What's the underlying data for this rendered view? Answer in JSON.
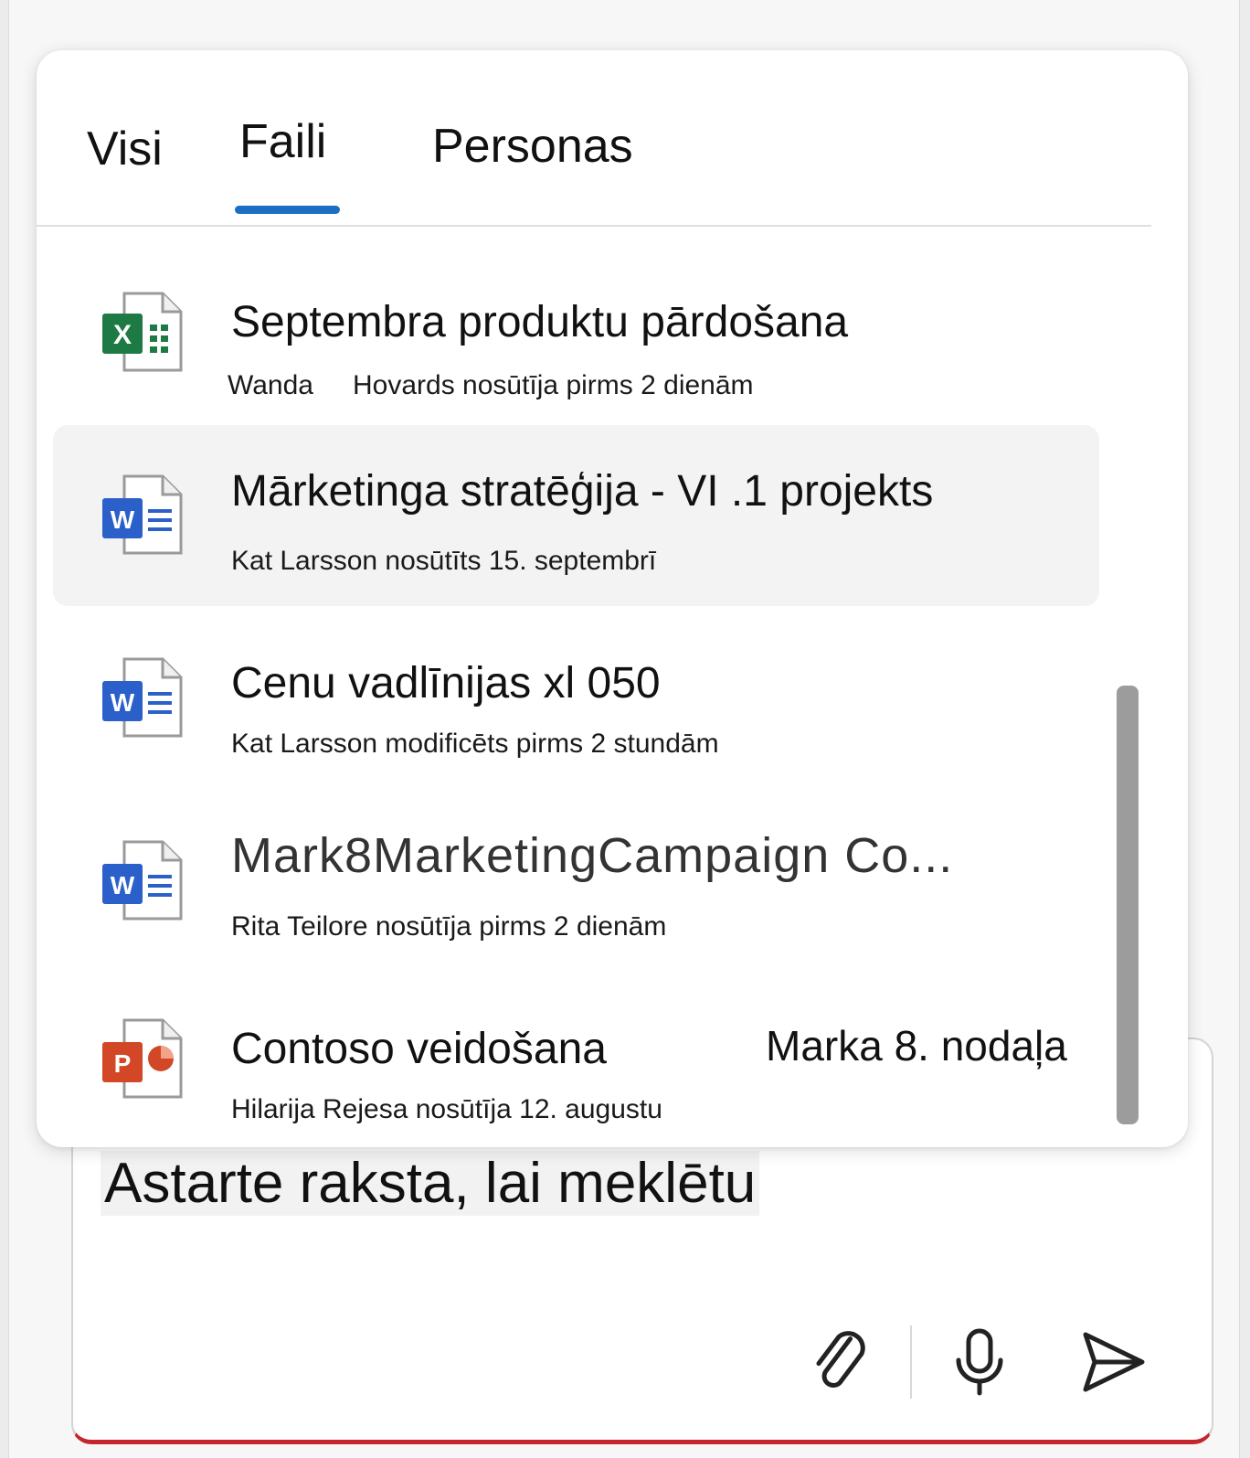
{
  "tabs": [
    {
      "label": "Visi"
    },
    {
      "label": "Faili"
    },
    {
      "label": "Personas"
    }
  ],
  "files": [
    {
      "icon": "excel-icon",
      "title": "Septembra produktu pārdošana",
      "sub_a": "Wanda",
      "sub_b": "Hovards nosūtīja pirms 2 dienām"
    },
    {
      "icon": "word-icon",
      "title": "Mārketinga stratēģija - VI .1 projekts",
      "sub": "Kat Larsson nosūtīts 15. septembrī"
    },
    {
      "icon": "word-icon",
      "title": "Cenu vadlīnijas xl 050",
      "sub": "Kat Larsson modificēts pirms 2 stundām"
    },
    {
      "icon": "word-icon",
      "title": "Mark8MarketingCampaign Co...",
      "sub": "Rita Teilore nosūtīja pirms 2 dienām"
    },
    {
      "icon": "powerpoint-icon",
      "title": "Contoso veidošana",
      "extra": "Marka 8. nodaļa",
      "sub": "Hilarija Rejesa nosūtīja 12. augustu"
    }
  ],
  "colors": {
    "accent": "#1a6fc4",
    "excel": "#1d7a45",
    "word": "#2b5fc9",
    "powerpoint": "#d24726",
    "composer_border": "#c4262e"
  },
  "composer": {
    "placeholder": "Astarte raksta, lai meklētu",
    "tools": [
      "paperclip-icon",
      "microphone-icon",
      "send-icon"
    ]
  }
}
